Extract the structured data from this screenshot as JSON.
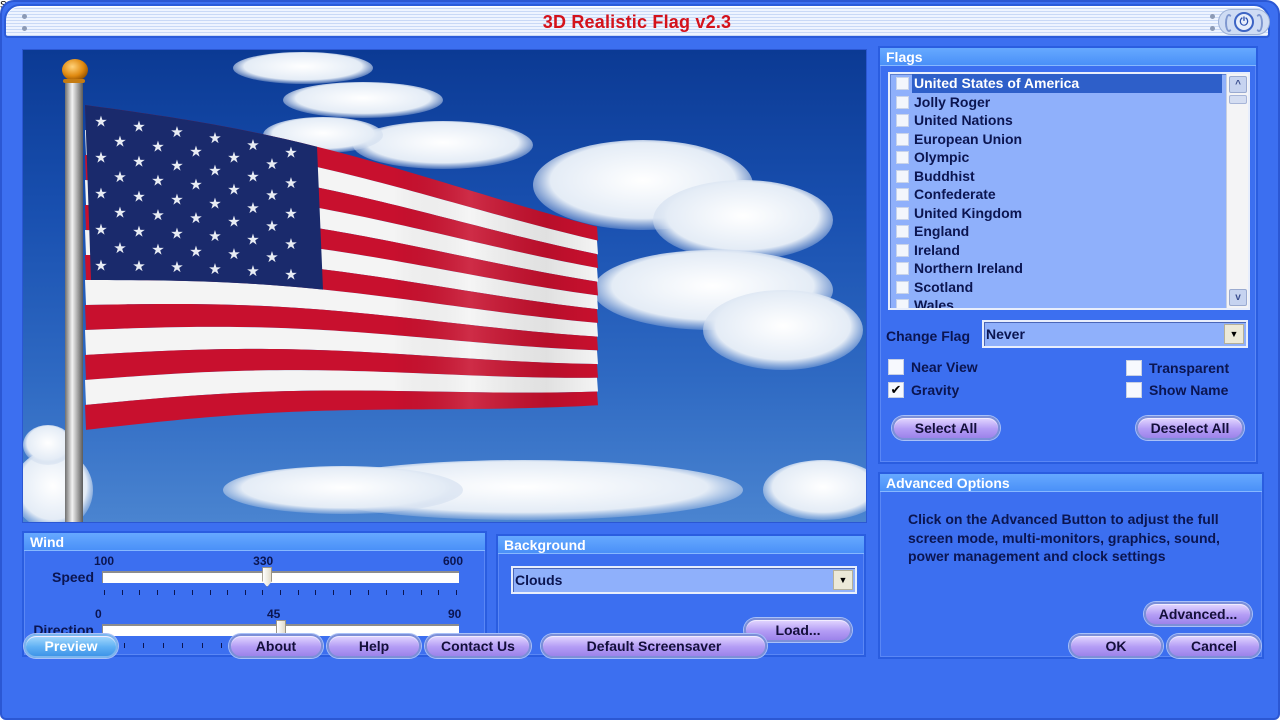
{
  "window": {
    "title": "3D Realistic Flag v2.3",
    "power_icon": "⏻"
  },
  "preview": {
    "scene": "US flag waving on a pole against a cloudy blue sky",
    "colors": {
      "stripe_red": "#c8102e",
      "stripe_white": "#f4f4f4",
      "canton": "#1a2a6c",
      "sky": "#1c56b5"
    }
  },
  "flags": {
    "header": "Flags",
    "items": [
      {
        "label": "United States of America",
        "checked": false,
        "selected": true
      },
      {
        "label": "Jolly Roger",
        "checked": false,
        "selected": false
      },
      {
        "label": "United Nations",
        "checked": false,
        "selected": false
      },
      {
        "label": "European Union",
        "checked": false,
        "selected": false
      },
      {
        "label": "Olympic",
        "checked": false,
        "selected": false
      },
      {
        "label": "Buddhist",
        "checked": false,
        "selected": false
      },
      {
        "label": "Confederate",
        "checked": false,
        "selected": false
      },
      {
        "label": "United Kingdom",
        "checked": false,
        "selected": false
      },
      {
        "label": "England",
        "checked": false,
        "selected": false
      },
      {
        "label": "Ireland",
        "checked": false,
        "selected": false
      },
      {
        "label": "Northern Ireland",
        "checked": false,
        "selected": false
      },
      {
        "label": "Scotland",
        "checked": false,
        "selected": false
      },
      {
        "label": "Wales",
        "checked": false,
        "selected": false
      }
    ],
    "scroll_up_icon": "^",
    "scroll_down_icon": "v",
    "change_flag_label": "Change Flag",
    "change_flag_value": "Never",
    "dropdown_icon": "▼",
    "options": {
      "near_view": {
        "label": "Near View",
        "checked": false
      },
      "gravity": {
        "label": "Gravity",
        "checked": true
      },
      "transparent": {
        "label": "Transparent",
        "checked": false
      },
      "show_name": {
        "label": "Show Name",
        "checked": false
      }
    },
    "check_glyph": "✔",
    "select_all": "Select All",
    "deselect_all": "Deselect All"
  },
  "wind": {
    "header": "Wind",
    "speed": {
      "label": "Speed",
      "min": 100,
      "max": 600,
      "value": 330,
      "min_label": "100",
      "max_label": "600",
      "value_label": "330",
      "ticks": 21
    },
    "direction": {
      "label": "Direction",
      "min": 0,
      "max": 90,
      "value": 45,
      "min_label": "0",
      "max_label": "90",
      "value_label": "45",
      "ticks": 19
    }
  },
  "background": {
    "header": "Background",
    "value": "Clouds",
    "load": "Load..."
  },
  "advanced": {
    "header": "Advanced Options",
    "description": "Click on the Advanced Button to adjust the full screen mode, multi-monitors, graphics, sound, power management and clock settings",
    "button": "Advanced..."
  },
  "buttons": {
    "preview": "Preview",
    "about": "About",
    "help": "Help",
    "contact": "Contact Us",
    "default_screensaver": "Default Screensaver",
    "ok": "OK",
    "cancel": "Cancel"
  }
}
